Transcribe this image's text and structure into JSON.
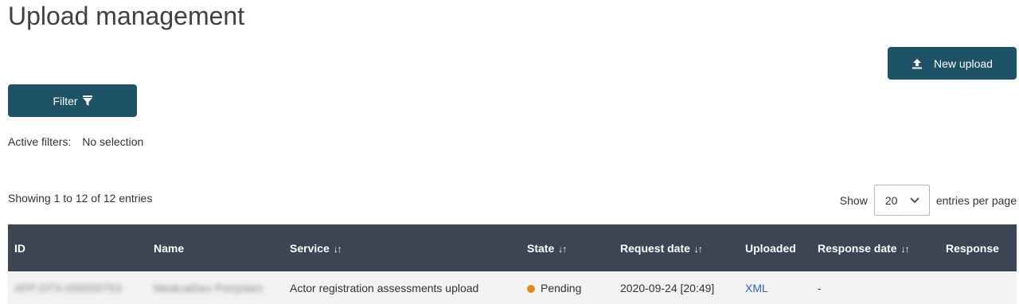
{
  "page": {
    "title": "Upload management"
  },
  "actions": {
    "new_upload": "New upload",
    "filter": "Filter"
  },
  "filters": {
    "label": "Active filters:",
    "value": "No selection"
  },
  "pagination": {
    "showing": "Showing 1 to 12 of 12 entries",
    "show_label": "Show",
    "page_size": "20",
    "suffix": "entries per page"
  },
  "table": {
    "columns": [
      "ID",
      "Name",
      "Service",
      "State",
      "Request date",
      "Uploaded",
      "Response date",
      "Response"
    ],
    "rows": [
      {
        "id": "AFP-DTX-000000753",
        "name": "MedicalDev Portydam",
        "service": "Actor registration assessments upload",
        "state": "Pending",
        "request_date": "2020-09-24 [20:49]",
        "uploaded": "XML",
        "response_date": "-",
        "response": ""
      }
    ]
  },
  "colors": {
    "primary_button": "#1e5367",
    "table_header": "#3c4553",
    "pending_dot": "#e08a1e",
    "link": "#2a66b0"
  }
}
